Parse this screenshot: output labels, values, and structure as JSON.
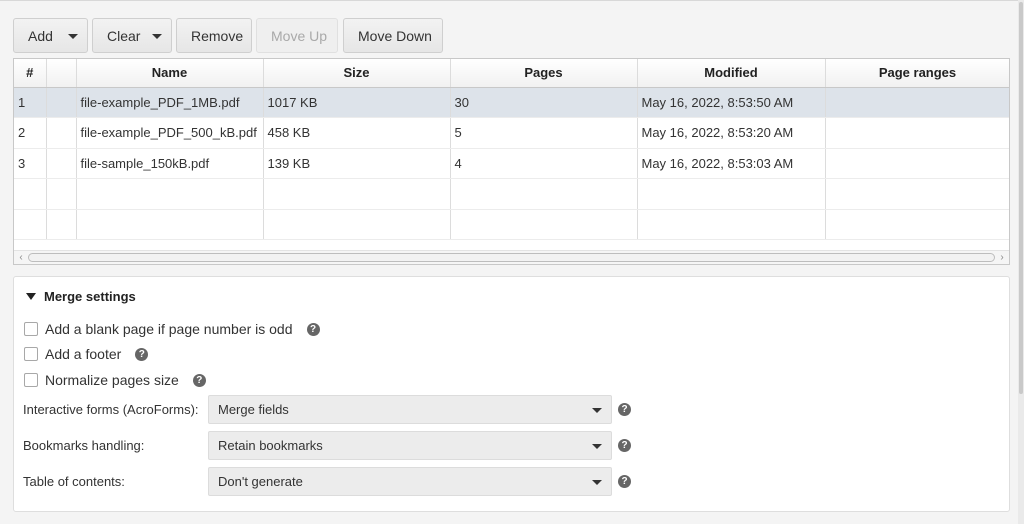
{
  "toolbar": {
    "add_label": "Add",
    "clear_label": "Clear",
    "remove_label": "Remove",
    "move_up_label": "Move Up",
    "move_down_label": "Move Down"
  },
  "table": {
    "columns": [
      "#",
      "",
      "Name",
      "Size",
      "Pages",
      "Modified",
      "Page ranges"
    ],
    "rows": [
      {
        "index": "1",
        "name": "file-example_PDF_1MB.pdf",
        "size": "1017 KB",
        "pages": "30",
        "modified": "May 16, 2022, 8:53:50 AM",
        "ranges": "",
        "selected": true
      },
      {
        "index": "2",
        "name": "file-example_PDF_500_kB.pdf",
        "size": "458 KB",
        "pages": "5",
        "modified": "May 16, 2022, 8:53:20 AM",
        "ranges": "",
        "selected": false
      },
      {
        "index": "3",
        "name": "file-sample_150kB.pdf",
        "size": "139 KB",
        "pages": "4",
        "modified": "May 16, 2022, 8:53:03 AM",
        "ranges": "",
        "selected": false
      }
    ],
    "scroll_left_glyph": "‹",
    "scroll_right_glyph": "›"
  },
  "merge_settings": {
    "title": "Merge settings",
    "help_glyph": "?",
    "options": [
      {
        "label": "Add a blank page if page number is odd",
        "checked": false
      },
      {
        "label": "Add a footer",
        "checked": false
      },
      {
        "label": "Normalize pages size",
        "checked": false
      }
    ],
    "fields": [
      {
        "label": "Interactive forms (AcroForms):",
        "value": "Merge fields"
      },
      {
        "label": "Bookmarks handling:",
        "value": "Retain bookmarks"
      },
      {
        "label": "Table of contents:",
        "value": "Don't generate"
      }
    ]
  },
  "colors": {
    "selected_row": "#dde3ea",
    "disabled_text": "#a9a9a9"
  }
}
